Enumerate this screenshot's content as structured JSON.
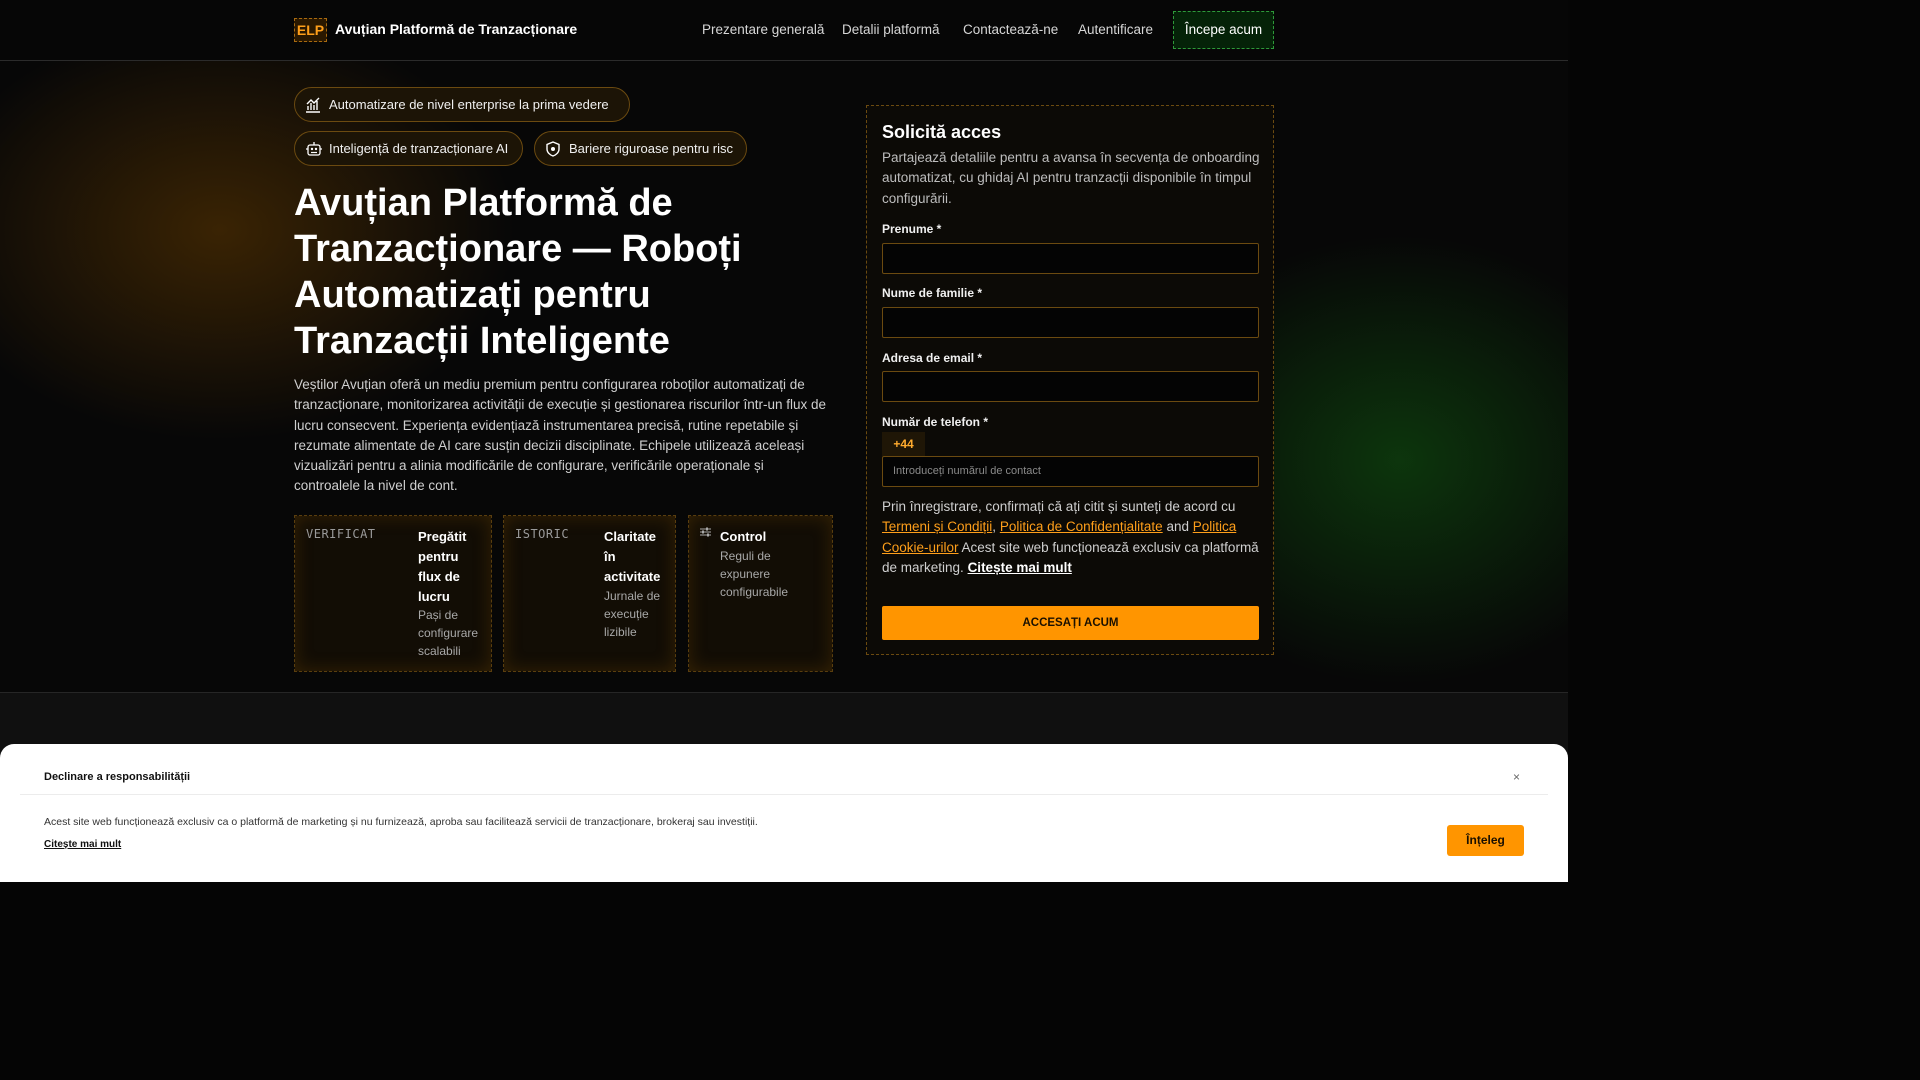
{
  "header": {
    "logo": "ELP",
    "brand": "Avuțian Platformă de Tranzacționare",
    "nav": [
      "Prezentare generală",
      "Detalii platformă",
      "Contactează-ne",
      "Autentificare"
    ],
    "cta": "Începe acum"
  },
  "hero": {
    "badges": [
      {
        "label": "Automatizare de nivel enterprise la prima vedere",
        "icon": "chart-icon"
      },
      {
        "label": "Inteligență de tranzacționare AI",
        "icon": "robot-icon"
      },
      {
        "label": "Bariere riguroase pentru risc",
        "icon": "shield-icon"
      }
    ],
    "title": "Avuțian Platformă de Tranzacționare — Roboți Automatizați pentru Tranzacții Inteligente",
    "description": "Veștilor Avuțian oferă un mediu premium pentru configurarea roboților automatizați de tranzacționare, monitorizarea activității de execuție și gestionarea riscurilor într-un flux de lucru consecvent. Experiența evidențiază instrumentarea precisă, rutine repetabile și rezumate alimentate de AI care susțin decizii disciplinate. Echipele utilizează aceleași vizualizări pentru a alinia modificările de configurare, verificările operaționale și controalele la nivel de cont.",
    "cards": [
      {
        "tag": "VERIFICAT",
        "title": "Pregătit pentru flux de lucru",
        "subtitle": "Pași de configurare scalabili"
      },
      {
        "tag": "ISTORIC",
        "title": "Claritate în activitate",
        "subtitle": "Jurnale de execuție lizibile"
      },
      {
        "tag": "",
        "title": "Control",
        "subtitle": "Reguli de expunere configurabile"
      }
    ]
  },
  "form": {
    "title": "Solicită acces",
    "intro": "Partajează detaliile pentru a avansa în secvența de onboarding automatizat, cu ghidaj AI pentru tranzacții disponibile în timpul configurării.",
    "fields": {
      "first_name": "Prenume *",
      "last_name": "Nume de familie *",
      "email": "Adresa de email *",
      "phone": "Număr de telefon *"
    },
    "phone_prefix": "+44",
    "phone_placeholder": "Introduceți numărul de contact",
    "legal": {
      "prefix": "Prin înregistrare, confirmați că ați citit și sunteți de acord cu",
      "terms": "Termeni și Condiții",
      "privacy": "Politica de Confidențialitate",
      "and": "and",
      "cookies": "Politica Cookie-urilor",
      "notice": "Acest site web funcționează exclusiv ca platformă de marketing.",
      "read_more": "Citește mai mult"
    },
    "submit": "ACCESAȚI ACUM"
  },
  "disclaimer": {
    "title": "Declinare a responsabilității",
    "close": "×",
    "text": "Acest site web funcționează exclusiv ca o platformă de marketing și nu furnizează, aproba sau facilitează servicii de tranzacționare, brokeraj sau investiții.",
    "link": "Citește mai mult",
    "button": "Înțeleg"
  },
  "colors": {
    "accent": "#ff9500",
    "cta_green": "#2e9a3a",
    "background": "#070707"
  }
}
